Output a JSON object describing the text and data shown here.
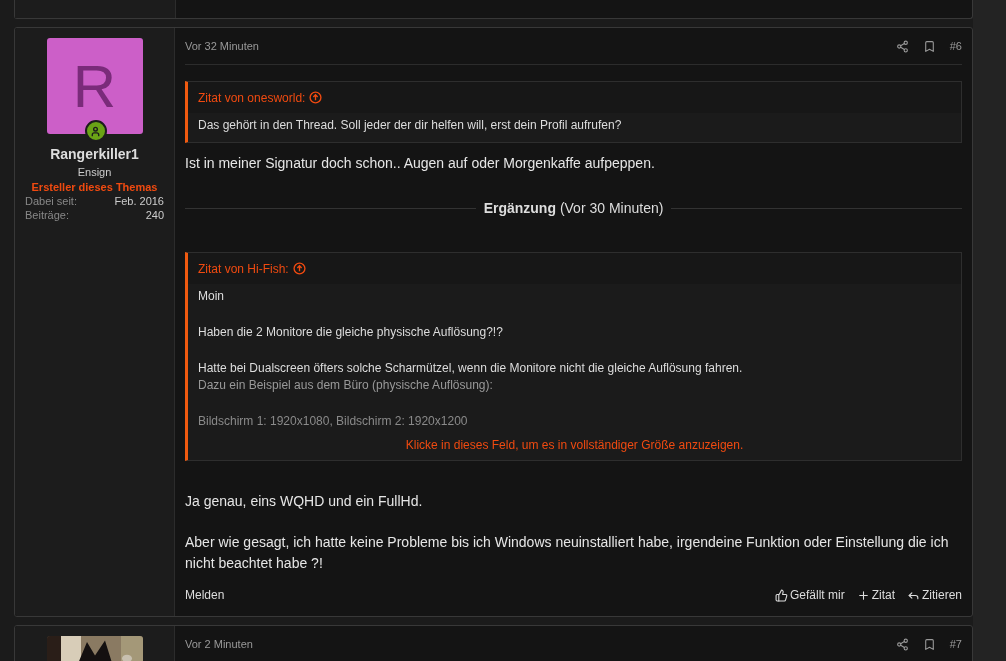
{
  "post": {
    "author": {
      "initial": "R",
      "online": true,
      "name": "Rangerkiller1",
      "rank": "Ensign",
      "badge": "Ersteller dieses Themas",
      "stats": [
        {
          "label": "Dabei seit:",
          "value": "Feb. 2016"
        },
        {
          "label": "Beiträge:",
          "value": "240"
        }
      ]
    },
    "time": "Vor 32 Minuten",
    "number": "#6",
    "blocks": [
      {
        "kind": "quote",
        "author": "Zitat von onesworld:",
        "paragraphs": [
          [
            "Das gehört in den Thread. Soll jeder der dir helfen will, erst dein Profil aufrufen?"
          ]
        ]
      },
      {
        "kind": "text",
        "text": "Ist in meiner Signatur doch schon.. Augen auf oder Morgenkaffe aufpeppen."
      },
      {
        "kind": "divider",
        "title": "Ergänzung",
        "note": "(Vor 30 Minuten)"
      },
      {
        "kind": "quote",
        "author": "Zitat von Hi-Fish:",
        "paragraphs": [
          [
            "Moin"
          ],
          [
            "Haben die 2 Monitore die gleiche physische Auflösung?!?"
          ],
          [
            "Hatte bei Dualscreen öfters solche Scharmützel, wenn die Monitore nicht die gleiche Auflösung fahren.",
            "Dazu ein Beispiel aus dem Büro (physische Auflösung):"
          ],
          [
            "Bildschirm 1: 1920x1080, Bildschirm 2: 1920x1200"
          ]
        ],
        "expand": "Klicke in dieses Feld, um es in vollständiger Größe anzuzeigen."
      },
      {
        "kind": "text",
        "text": "Ja genau, eins WQHD und ein FullHd."
      },
      {
        "kind": "text",
        "text": "Aber wie gesagt, ich hatte keine Probleme bis ich Windows neuinstalliert habe, irgendeine Funktion oder Einstellung die ich nicht beachtet habe ?!"
      }
    ],
    "actions_left": [
      "Melden"
    ],
    "actions_right": [
      {
        "kind": "like",
        "label": "Gefällt mir"
      },
      {
        "kind": "add",
        "label": "Zitat"
      },
      {
        "kind": "reply",
        "label": "Zitieren"
      }
    ]
  },
  "next_post": {
    "time": "Vor 2 Minuten",
    "number": "#7"
  }
}
